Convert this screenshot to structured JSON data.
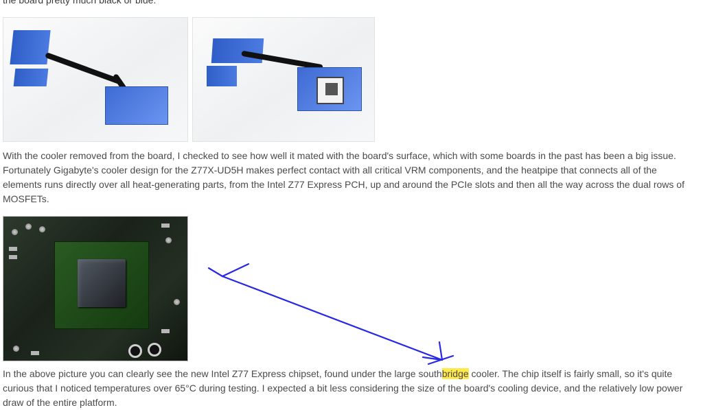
{
  "truncated_line": "the board pretty much black or blue.",
  "para1": "With the cooler removed from the board, I checked to see how well it mated with the board's surface, which with some boards in the past has been a big issue. Fortunately Gigabyte's cooler design for the Z77X-UD5H makes perfect contact with all critical VRM components, and the heatpipe that connects all of the elements runs directly over all heat-generating parts, from the Intel Z77 Express PCH, up and around the PCIe slots and then all the way across the dual rows of MOSFETs.",
  "para2_a": "In the above picture you can clearly see the new Intel Z77 Express chipset, found under the large south",
  "para2_hl": "bridge",
  "para2_b": " cooler. The chip itself is fairly small, so it's quite curious that I noticed temperatures over 65°C during testing. I expected a bit less considering the size of the board's cooling device, and the relatively low power draw of the entire platform."
}
